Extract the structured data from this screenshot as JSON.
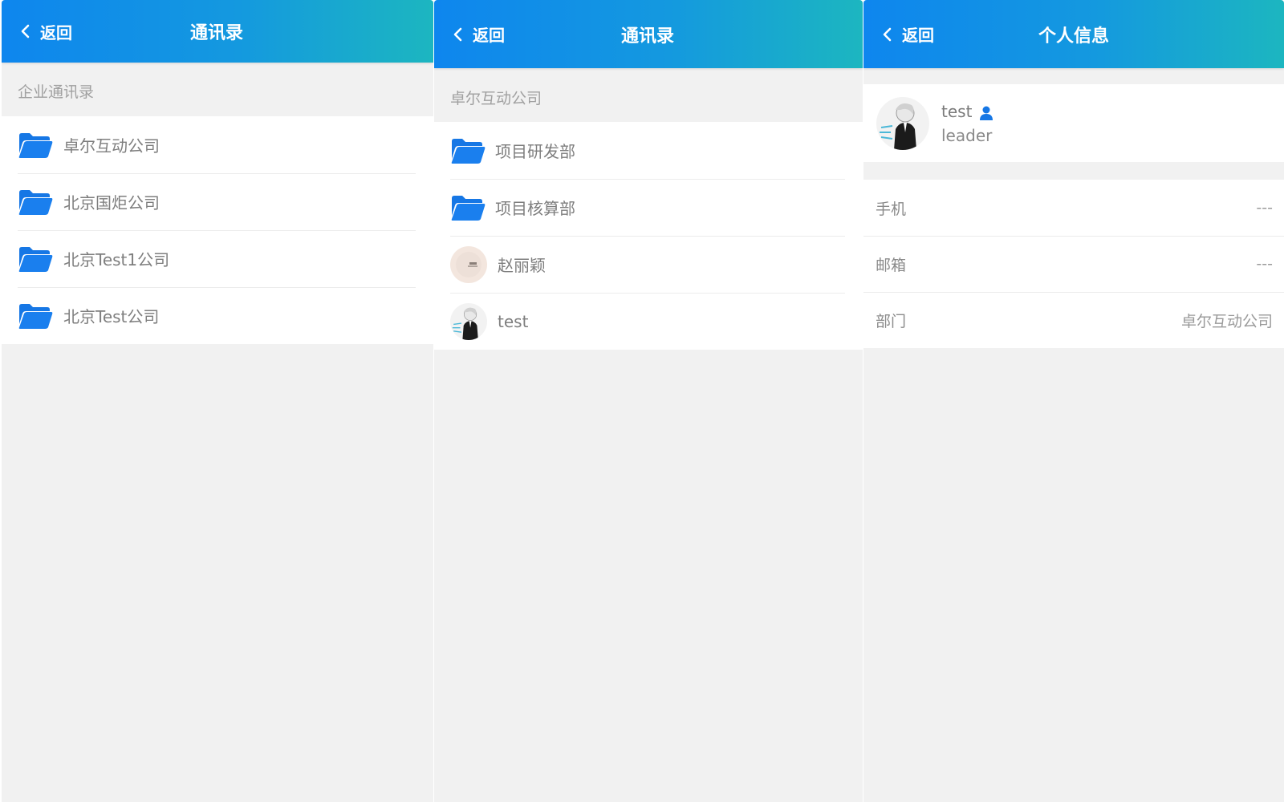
{
  "panels": [
    {
      "header": {
        "back_label": "返回",
        "title": "通讯录"
      },
      "section_label": "企业通讯录",
      "items": [
        {
          "label": "卓尔互动公司",
          "icon": "folder-icon"
        },
        {
          "label": "北京国炬公司",
          "icon": "folder-icon"
        },
        {
          "label": "北京Test1公司",
          "icon": "folder-icon"
        },
        {
          "label": "北京Test公司",
          "icon": "folder-icon"
        }
      ]
    },
    {
      "header": {
        "back_label": "返回",
        "title": "通讯录"
      },
      "section_label": "卓尔互动公司",
      "items": [
        {
          "label": "项目研发部",
          "icon": "folder-icon"
        },
        {
          "label": "项目核算部",
          "icon": "folder-icon"
        },
        {
          "label": "赵丽颖",
          "icon": "avatar"
        },
        {
          "label": "test",
          "icon": "avatar"
        }
      ]
    },
    {
      "header": {
        "back_label": "返回",
        "title": "个人信息"
      },
      "profile": {
        "name": "test",
        "role": "leader",
        "badge_icon": "user-icon"
      },
      "fields": [
        {
          "key": "手机",
          "value": "---"
        },
        {
          "key": "邮箱",
          "value": "---"
        },
        {
          "key": "部门",
          "value": "卓尔互动公司"
        }
      ]
    }
  ],
  "colors": {
    "header_start": "#0e86ee",
    "header_end": "#1cb6c0",
    "folder": "#1677e5",
    "page_bg": "#f1f1f1"
  }
}
